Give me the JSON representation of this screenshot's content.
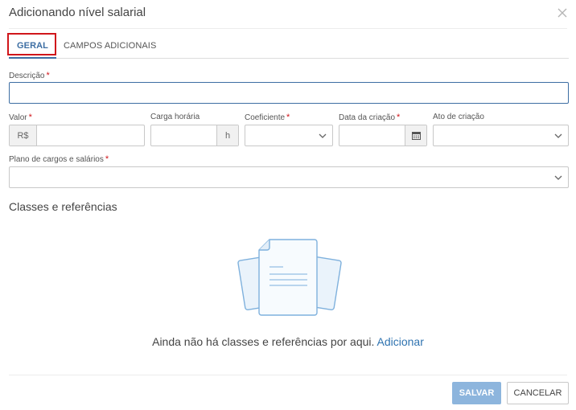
{
  "modal": {
    "title": "Adicionando nível salarial"
  },
  "tabs": [
    {
      "label": "GERAL"
    },
    {
      "label": "CAMPOS ADICIONAIS"
    }
  ],
  "fields": {
    "descricao": {
      "label": "Descrição",
      "required": "*",
      "value": ""
    },
    "valor": {
      "label": "Valor",
      "required": "*",
      "prefix": "R$",
      "value": ""
    },
    "carga": {
      "label": "Carga horária",
      "suffix": "h",
      "value": ""
    },
    "coeficiente": {
      "label": "Coeficiente",
      "required": "*",
      "value": ""
    },
    "data": {
      "label": "Data da criação",
      "required": "*",
      "value": ""
    },
    "ato": {
      "label": "Ato de criação",
      "value": ""
    },
    "plano": {
      "label": "Plano de cargos e salários",
      "required": "*",
      "value": ""
    }
  },
  "section": {
    "title": "Classes e referências",
    "empty_text": "Ainda não há classes e referências por aqui.",
    "empty_link": "Adicionar"
  },
  "footer": {
    "save_label": "SALVAR",
    "cancel_label": "CANCELAR"
  },
  "colors": {
    "accent": "#3d6ea3",
    "highlight": "#d0161b",
    "save_button": "#8db5dd",
    "link": "#2f73b0"
  },
  "icons": {
    "close": "close-icon",
    "chevron": "chevron-down-icon",
    "calendar": "calendar-icon",
    "empty": "empty-documents-icon"
  }
}
